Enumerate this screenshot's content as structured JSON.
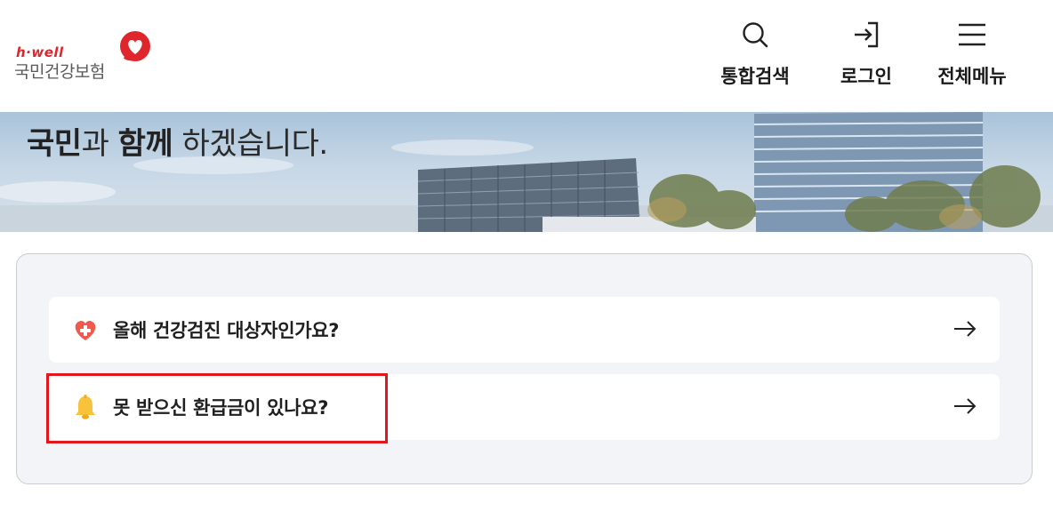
{
  "header": {
    "logo": {
      "tagline": "h·well",
      "name": "국민건강보험"
    },
    "nav": [
      {
        "label": "통합검색",
        "icon": "search-icon"
      },
      {
        "label": "로그인",
        "icon": "login-icon"
      },
      {
        "label": "전체메뉴",
        "icon": "menu-icon"
      }
    ]
  },
  "banner": {
    "text_part1": "국민",
    "text_part2": "과 ",
    "text_part3": "함께",
    "text_part4": " 하겠습니다."
  },
  "quick_links": [
    {
      "label": "올해 건강검진 대상자인가요?",
      "icon": "heart-plus-icon"
    },
    {
      "label": "못 받으신 환급금이 있나요?",
      "icon": "bell-icon"
    }
  ],
  "colors": {
    "brand_red": "#e0262d",
    "highlight_red": "#e3161b",
    "card_bg": "#f2f4f8"
  }
}
